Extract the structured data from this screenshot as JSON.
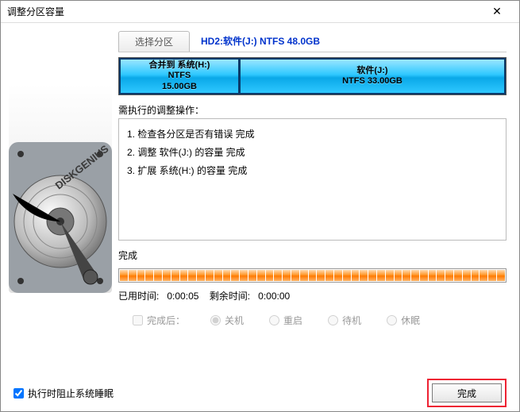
{
  "window": {
    "title": "调整分区容量"
  },
  "tab": {
    "select_label": "选择分区",
    "info": "HD2:软件(J:) NTFS 48.0GB"
  },
  "partitions": [
    {
      "line1": "合并到 系统(H:)",
      "line2": "NTFS",
      "line3": "15.00GB",
      "width_pct": 31
    },
    {
      "line1": "软件(J:)",
      "line2": "NTFS 33.00GB",
      "line3": "",
      "width_pct": 69
    }
  ],
  "ops": {
    "header": "需执行的调整操作：",
    "items": [
      "1. 检查各分区是否有错误  完成",
      "2. 调整 软件(J:) 的容量   完成",
      "3. 扩展 系统(H:) 的容量   完成"
    ]
  },
  "status_text": "完成",
  "time": {
    "elapsed_label": "已用时间:",
    "elapsed": "0:00:05",
    "remain_label": "剩余时间:",
    "remain": "0:00:00"
  },
  "after": {
    "checkbox_label": "完成后：",
    "options": {
      "shutdown": "关机",
      "restart": "重启",
      "standby": "待机",
      "hibernate": "休眠"
    }
  },
  "footer": {
    "prevent_sleep": "执行时阻止系统睡眠",
    "finish": "完成"
  }
}
